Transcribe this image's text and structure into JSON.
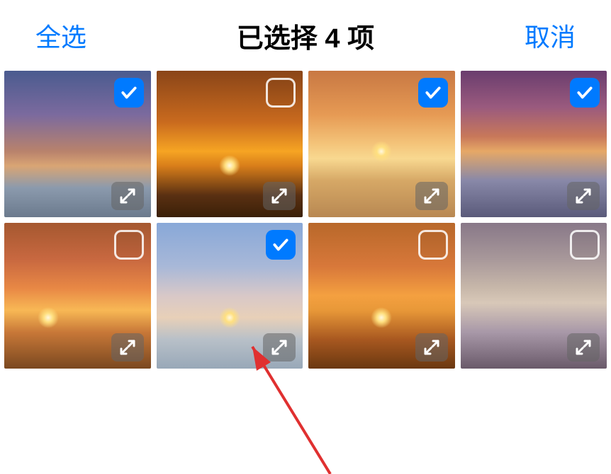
{
  "header": {
    "select_all": "全选",
    "title": "已选择 4 项",
    "cancel": "取消"
  },
  "selected_count": 4,
  "photos": [
    {
      "id": 0,
      "selected": true,
      "gradient": "g1",
      "sun": ""
    },
    {
      "id": 1,
      "selected": false,
      "gradient": "g2",
      "sun": "sun sun-low"
    },
    {
      "id": 2,
      "selected": true,
      "gradient": "g3",
      "sun": "sun"
    },
    {
      "id": 3,
      "selected": true,
      "gradient": "g4",
      "sun": ""
    },
    {
      "id": 4,
      "selected": false,
      "gradient": "g5",
      "sun": "sun sun-left sun-low"
    },
    {
      "id": 5,
      "selected": true,
      "gradient": "g6",
      "sun": "sun sun-low"
    },
    {
      "id": 6,
      "selected": false,
      "gradient": "g7",
      "sun": "sun sun-low"
    },
    {
      "id": 7,
      "selected": false,
      "gradient": "g8",
      "sun": ""
    }
  ],
  "colors": {
    "accent": "#007aff"
  },
  "icons": {
    "check": "checkmark-icon",
    "expand": "expand-icon",
    "pointer": "annotation-arrow-icon"
  }
}
